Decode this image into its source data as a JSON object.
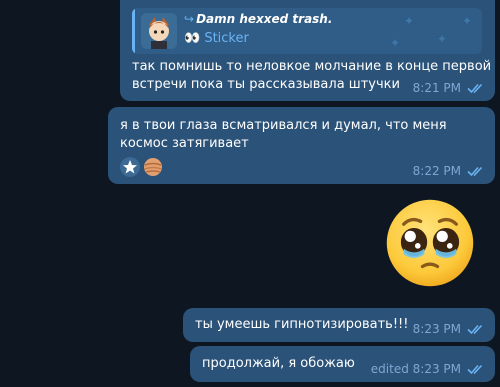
{
  "messages": [
    {
      "reply": {
        "author": "Damn hexxed trash.",
        "arrow_glyph": "↪",
        "emoji": "👀",
        "label": "Sticker"
      },
      "text": "так помнишь то неловкое молчание в конце первой встречи пока ты рассказывала штучки",
      "time": "8:21 PM"
    },
    {
      "text": "я в твои глаза всматривался и думал, что меня космос затягивает",
      "time": "8:22 PM",
      "custom_emoji": [
        "star-icon",
        "planet-icon"
      ]
    },
    {
      "sticker": "pleading-face-emoji"
    },
    {
      "text": "ты умеешь гипнотизировать!!!",
      "time": "8:23 PM"
    },
    {
      "text": "продолжай, я обожаю",
      "time": "edited 8:23 PM"
    }
  ],
  "colors": {
    "background": "#0e1621",
    "bubble_outgoing": "#2b5278",
    "accent": "#6ab3f3",
    "meta": "#7da8d3"
  }
}
